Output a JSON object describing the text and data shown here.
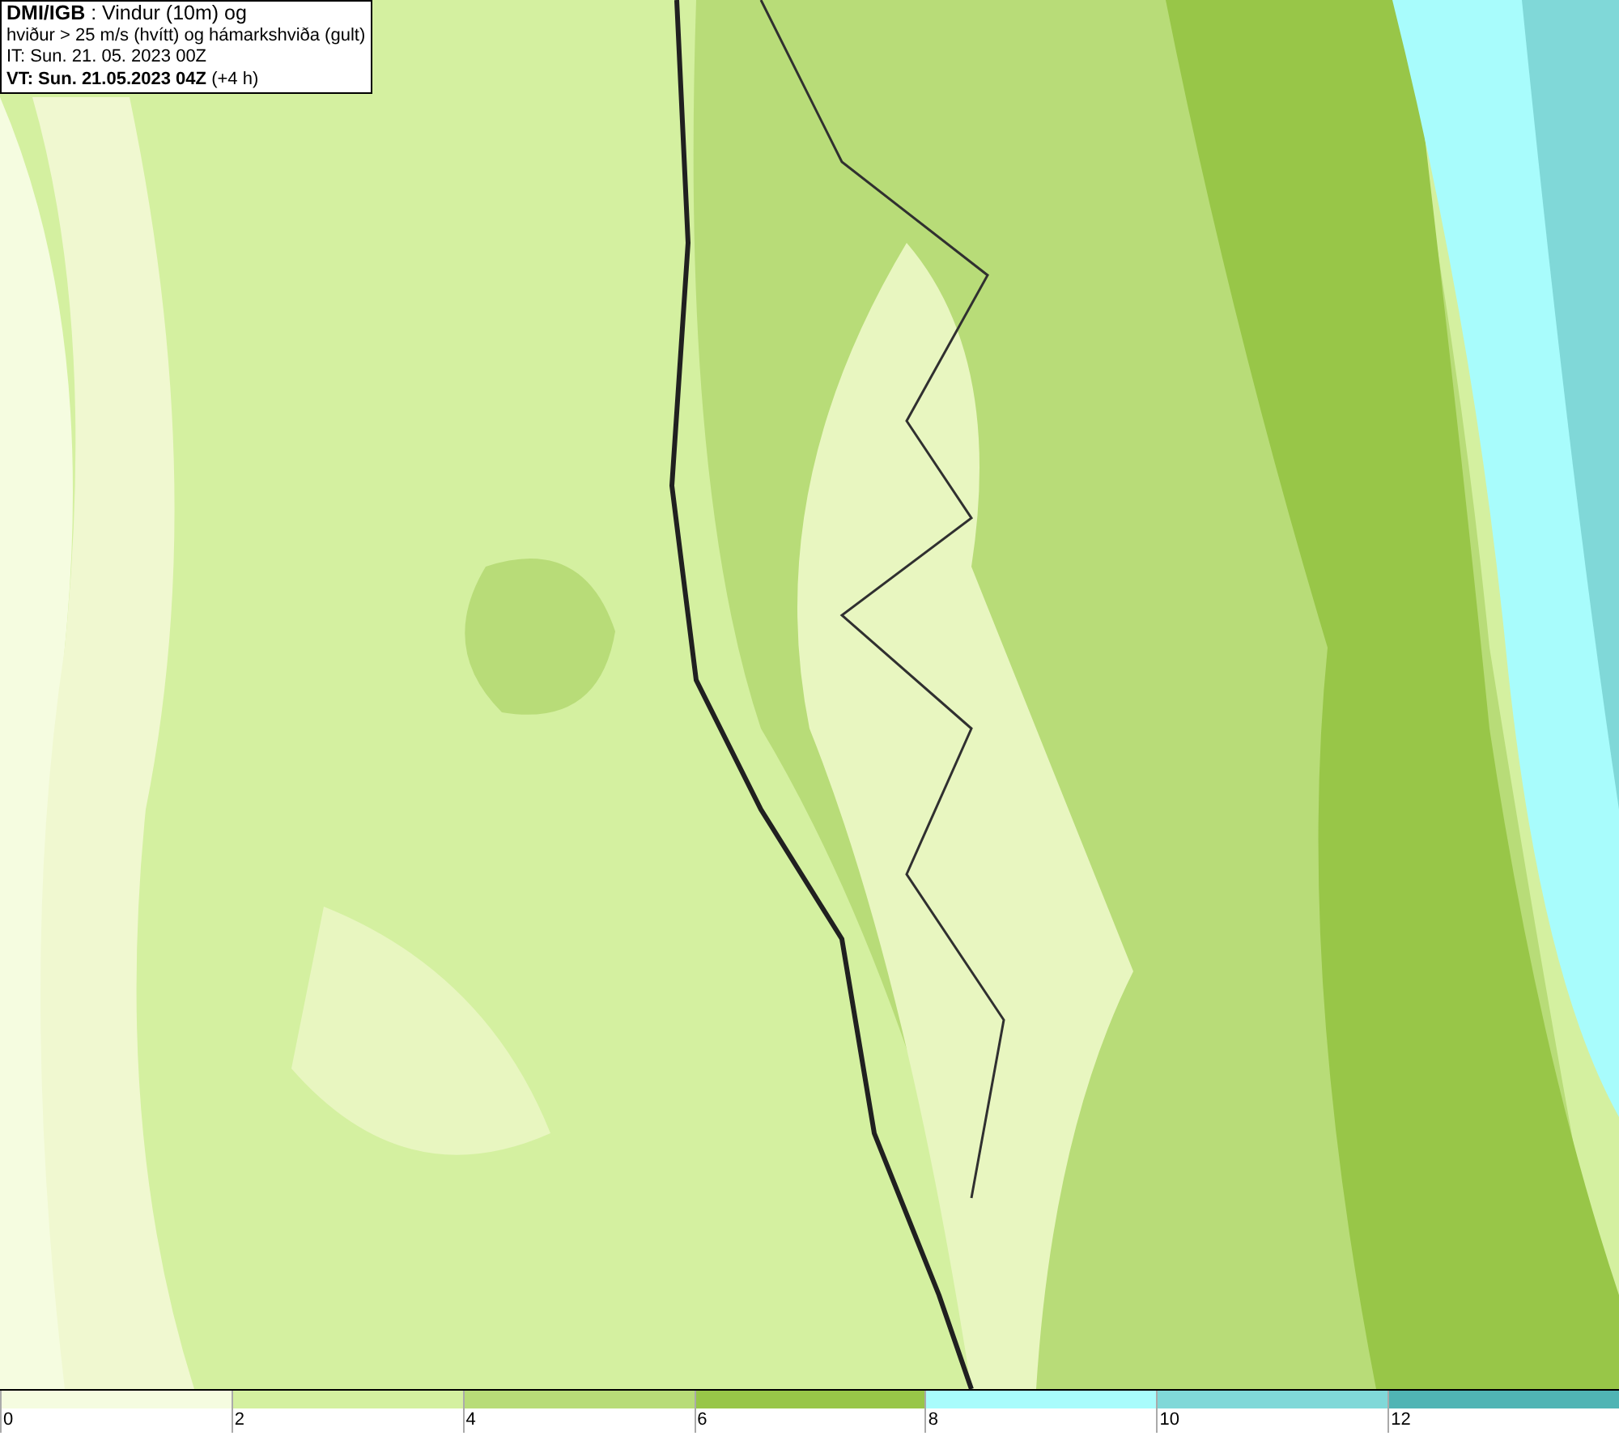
{
  "header": {
    "lines": [
      "**DMI/IGB** : Vindur (10m) og",
      "hviður > 25 m/s (hvítt) og hámarkshviða (gult)",
      "IT: Sun. 21. 05. 2023 00Z",
      "**VT: Sun. 21.05.2023 04Z** (+4 h)"
    ]
  },
  "legend": [
    {
      "label": "0",
      "color": "#f5fce0"
    },
    {
      "label": "2",
      "color": "#d4f0a0"
    },
    {
      "label": "4",
      "color": "#b8dc78"
    },
    {
      "label": "6",
      "color": "#98c648"
    },
    {
      "label": "8",
      "color": "#a8fcfc"
    },
    {
      "label": "10",
      "color": "#80d8d8"
    },
    {
      "label": "12",
      "color": "#50b4b4"
    }
  ]
}
